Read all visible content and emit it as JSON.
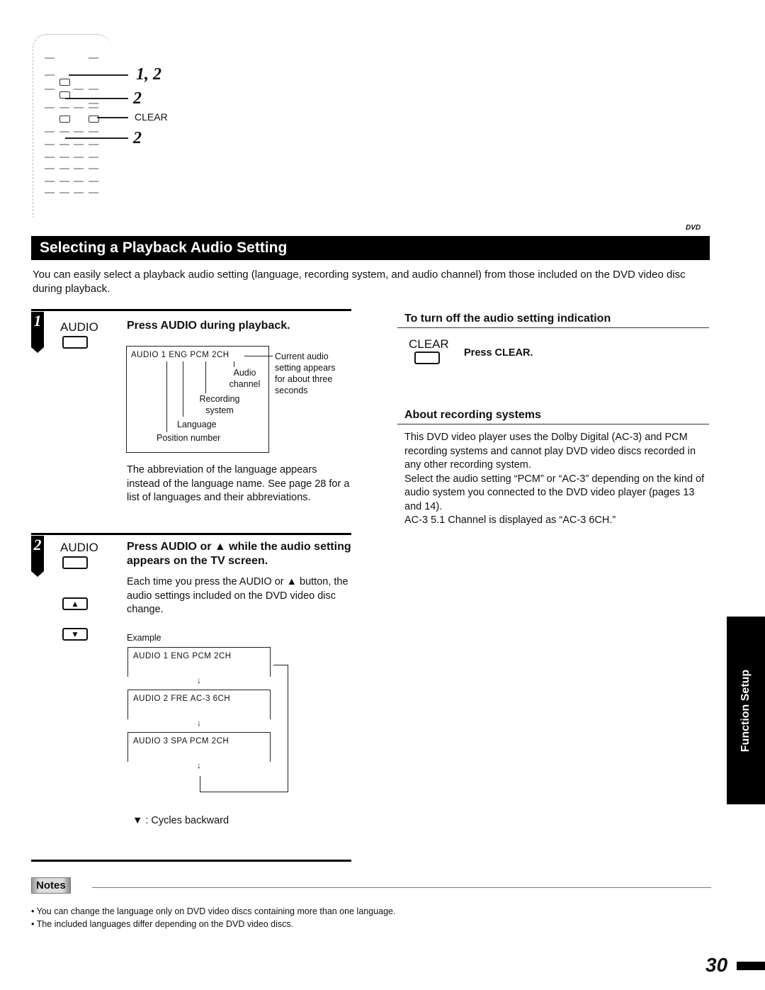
{
  "remote_diagram": {
    "callouts": [
      "1, 2",
      "2",
      "CLEAR",
      "2"
    ]
  },
  "header": {
    "logo": "DVD",
    "title": "Selecting a Playback Audio Setting"
  },
  "intro": "You can easily select a playback audio setting (language, recording system, and audio channel) from those included on the DVD video disc during playback.",
  "step1": {
    "number": "1",
    "button_label": "AUDIO",
    "heading": "Press AUDIO during playback.",
    "osd": {
      "display": "AUDIO  1  ENG  PCM   2CH",
      "labels": {
        "audio_channel": "Audio channel",
        "recording_system": "Recording system",
        "language": "Language",
        "position_number": "Position number"
      },
      "note": "Current audio setting appears for about three seconds"
    },
    "body": "The abbreviation of the language appears instead of the language name. See page 28 for a list of languages and their abbreviations."
  },
  "step2": {
    "number": "2",
    "button_label": "AUDIO",
    "heading": "Press AUDIO or ▲ while the audio setting appears on the TV screen.",
    "body": "Each time you press the AUDIO or ▲ button, the audio settings included on the DVD video disc change.",
    "example_label": "Example",
    "examples": [
      "AUDIO  1  ENG  PCM   2CH",
      "AUDIO  2  FRE  AC-3   6CH",
      "AUDIO  3  SPA  PCM   2CH"
    ],
    "arrow": "↓",
    "backward_note": "▼ : Cycles backward",
    "icons": [
      "up-arrow-button",
      "down-arrow-button"
    ]
  },
  "turn_off": {
    "heading": "To turn off the audio setting indication",
    "button_label": "CLEAR",
    "instruction": "Press CLEAR."
  },
  "recording_systems": {
    "heading": "About recording systems",
    "paragraphs": [
      "This DVD video player uses the Dolby Digital (AC-3) and PCM recording systems and cannot play DVD video discs recorded in any other recording system.",
      "Select the audio setting “PCM” or “AC-3” depending on the kind of audio system you connected to the DVD video player (pages 13 and 14).",
      "AC-3 5.1 Channel is displayed as “AC-3 6CH.”"
    ]
  },
  "side_tab": "Function Setup",
  "notes": {
    "label": "Notes",
    "items": [
      "• You can change the language only on DVD video discs containing more than one language.",
      "• The included languages differ depending on the DVD video discs."
    ]
  },
  "page_number": "30"
}
